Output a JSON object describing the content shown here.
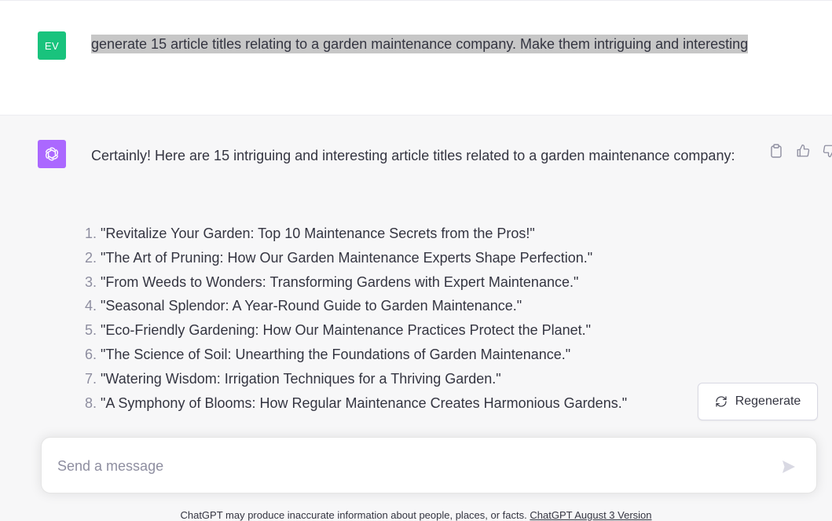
{
  "user_message": {
    "avatar_initials": "EV",
    "avatar_color": "#19c37d",
    "text": "generate 15 article titles relating to a garden maintenance company. Make them intriguing and interesting"
  },
  "assistant_message": {
    "avatar_icon": "openai-logo-icon",
    "avatar_color": "#ab68ff",
    "intro": "Certainly! Here are 15 intriguing and interesting article titles related to a garden maintenance company:",
    "titles": [
      {
        "num": "1.",
        "text": "\"Revitalize Your Garden: Top 10 Maintenance Secrets from the Pros!\""
      },
      {
        "num": "2.",
        "text": "\"The Art of Pruning: How Our Garden Maintenance Experts Shape Perfection.\""
      },
      {
        "num": "3.",
        "text": "\"From Weeds to Wonders: Transforming Gardens with Expert Maintenance.\""
      },
      {
        "num": "4.",
        "text": "\"Seasonal Splendor: A Year-Round Guide to Garden Maintenance.\""
      },
      {
        "num": "5.",
        "text": "\"Eco-Friendly Gardening: How Our Maintenance Practices Protect the Planet.\""
      },
      {
        "num": "6.",
        "text": "\"The Science of Soil: Unearthing the Foundations of Garden Maintenance.\""
      },
      {
        "num": "7.",
        "text": "\"Watering Wisdom: Irrigation Techniques for a Thriving Garden.\""
      },
      {
        "num": "8.",
        "text": "\"A Symphony of Blooms: How Regular Maintenance Creates Harmonious Gardens.\""
      }
    ],
    "actions": [
      "copy-icon",
      "thumbs-up-icon",
      "thumbs-down-icon"
    ]
  },
  "regenerate": {
    "label": "Regenerate",
    "icon": "refresh-icon"
  },
  "composer": {
    "placeholder": "Send a message",
    "send_icon": "send-icon"
  },
  "footer": {
    "disclaimer": "ChatGPT may produce inaccurate information about people, places, or facts.",
    "version_link": "ChatGPT August 3 Version"
  }
}
